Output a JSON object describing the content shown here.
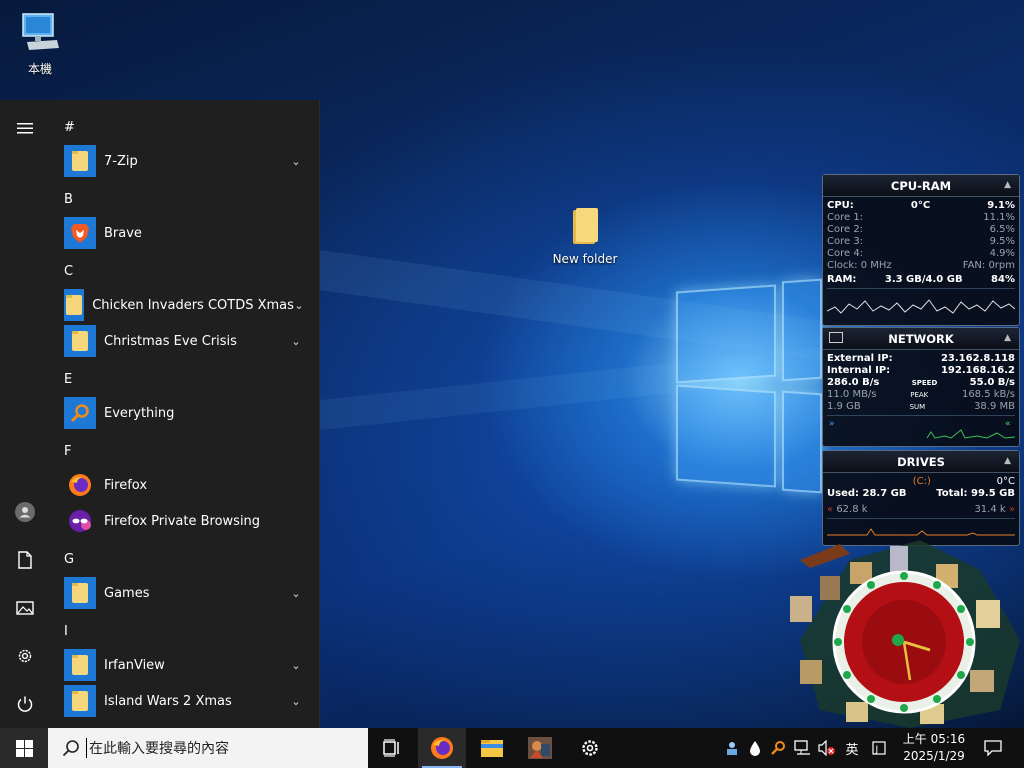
{
  "desktop": {
    "icons": [
      {
        "label": "本機",
        "icon": "computer-icon"
      },
      {
        "label": "New folder",
        "icon": "folder-icon"
      }
    ]
  },
  "start_menu": {
    "rail": [
      "hamburger-icon",
      "user-avatar-icon",
      "documents-icon",
      "pictures-icon",
      "settings-icon",
      "power-icon"
    ],
    "groups": [
      {
        "letter": "#",
        "apps": [
          {
            "name": "7-Zip",
            "icon": "folder-icon",
            "expandable": true
          }
        ]
      },
      {
        "letter": "B",
        "apps": [
          {
            "name": "Brave",
            "icon": "brave-icon",
            "expandable": false
          }
        ]
      },
      {
        "letter": "C",
        "apps": [
          {
            "name": "Chicken Invaders COTDS Xmas",
            "icon": "folder-icon",
            "expandable": true
          },
          {
            "name": "Christmas Eve Crisis",
            "icon": "folder-icon",
            "expandable": true
          }
        ]
      },
      {
        "letter": "E",
        "apps": [
          {
            "name": "Everything",
            "icon": "everything-search-icon",
            "expandable": false
          }
        ]
      },
      {
        "letter": "F",
        "apps": [
          {
            "name": "Firefox",
            "icon": "firefox-icon",
            "expandable": false
          },
          {
            "name": "Firefox Private Browsing",
            "icon": "firefox-private-icon",
            "expandable": false
          }
        ]
      },
      {
        "letter": "G",
        "apps": [
          {
            "name": "Games",
            "icon": "folder-icon",
            "expandable": true
          }
        ]
      },
      {
        "letter": "I",
        "apps": [
          {
            "name": "IrfanView",
            "icon": "folder-icon",
            "expandable": true
          },
          {
            "name": "Island Wars 2 Xmas",
            "icon": "folder-icon",
            "expandable": true
          }
        ]
      }
    ]
  },
  "gadgets": {
    "cpu_ram": {
      "title": "CPU-RAM",
      "cpu_label": "CPU:",
      "cpu_temp": "0°C",
      "cpu_value": "9.1%",
      "cores": [
        {
          "label": "Core 1:",
          "value": "11.1%"
        },
        {
          "label": "Core 2:",
          "value": "6.5%"
        },
        {
          "label": "Core 3:",
          "value": "9.5%"
        },
        {
          "label": "Core 4:",
          "value": "4.9%"
        }
      ],
      "clock": "Clock: 0 MHz",
      "fan": "FAN: 0rpm",
      "ram_label": "RAM:",
      "ram_usage": "3.3 GB/4.0 GB",
      "ram_pct": "84%"
    },
    "network": {
      "title": "NETWORK",
      "external_ip_label": "External IP:",
      "external_ip": "23.162.8.118",
      "internal_ip_label": "Internal IP:",
      "internal_ip": "192.168.16.2",
      "rows": [
        {
          "left": "286.0 B/s",
          "mid": "SPEED",
          "right": "55.0 B/s"
        },
        {
          "left": "11.0 MB/s",
          "mid": "PEAK",
          "right": "168.5 kB/s"
        },
        {
          "left": "1.9 GB",
          "mid": "SUM",
          "right": "38.9 MB"
        }
      ]
    },
    "drives": {
      "title": "DRIVES",
      "drive": "(C:)",
      "temp": "0°C",
      "used": "Used: 28.7 GB",
      "total": "Total: 99.5 GB",
      "read": "62.8 k",
      "write": "31.4 k"
    }
  },
  "taskbar": {
    "search_placeholder": "在此輸入要搜尋的內容",
    "pinned": [
      "task-view-icon",
      "firefox-icon",
      "file-explorer-icon",
      "game-icon",
      "settings-icon"
    ],
    "tray": {
      "ime": "英",
      "time": "上午 05:16",
      "date": "2025/1/29"
    }
  },
  "colors": {
    "start_menu_bg": "#1f1f1f",
    "tile_blue": "#1e78d6",
    "taskbar_bg": "#101010",
    "folder_yellow": "#f5d67a"
  }
}
